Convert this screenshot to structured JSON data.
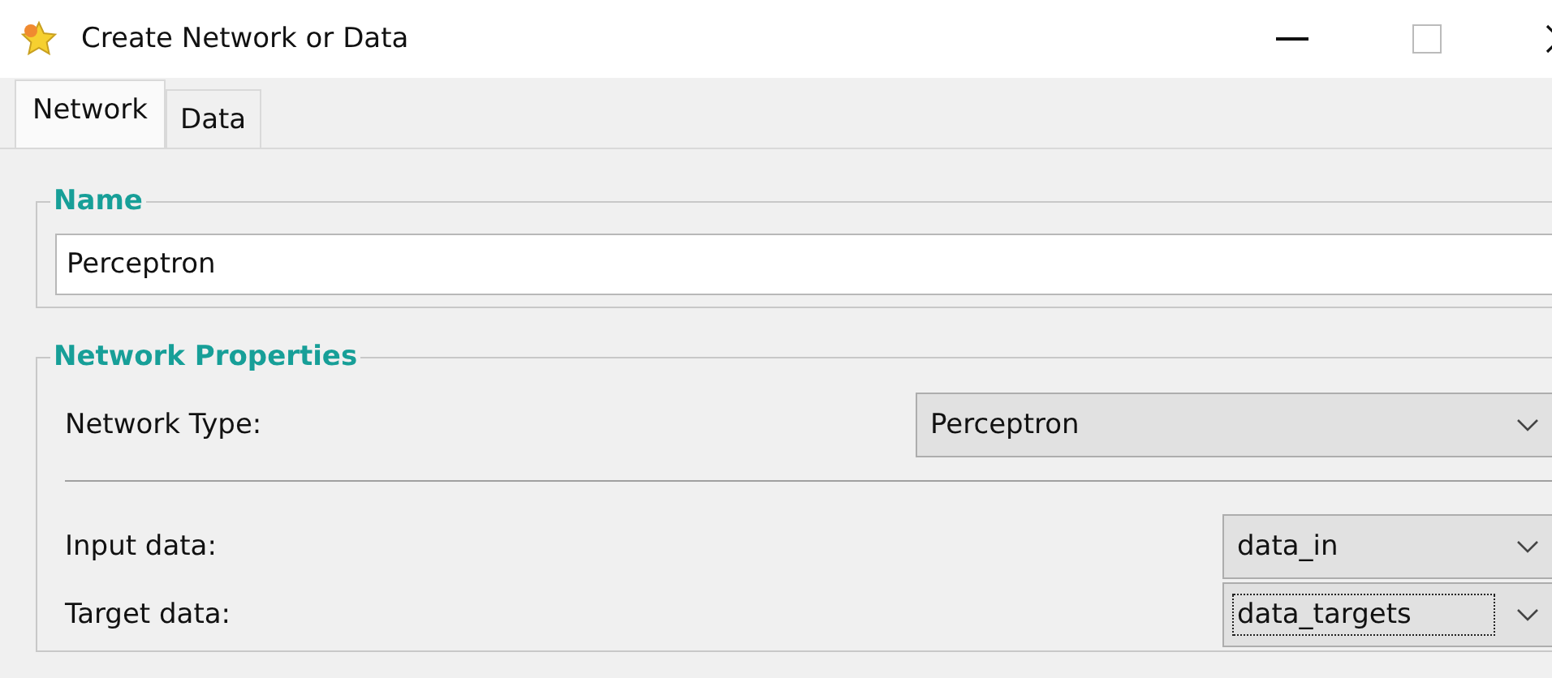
{
  "window": {
    "title": "Create Network or Data"
  },
  "tabs": [
    {
      "label": "Network",
      "selected": true
    },
    {
      "label": "Data",
      "selected": false
    }
  ],
  "name_group": {
    "legend": "Name",
    "value": "Perceptron"
  },
  "properties_group": {
    "legend": "Network Properties",
    "network_type": {
      "label": "Network Type:",
      "value": "Perceptron"
    },
    "data_rows": [
      {
        "label": "Input data:",
        "value": "data_in",
        "focused": false
      },
      {
        "label": "Target data:",
        "value": "data_targets",
        "focused": true
      }
    ]
  }
}
